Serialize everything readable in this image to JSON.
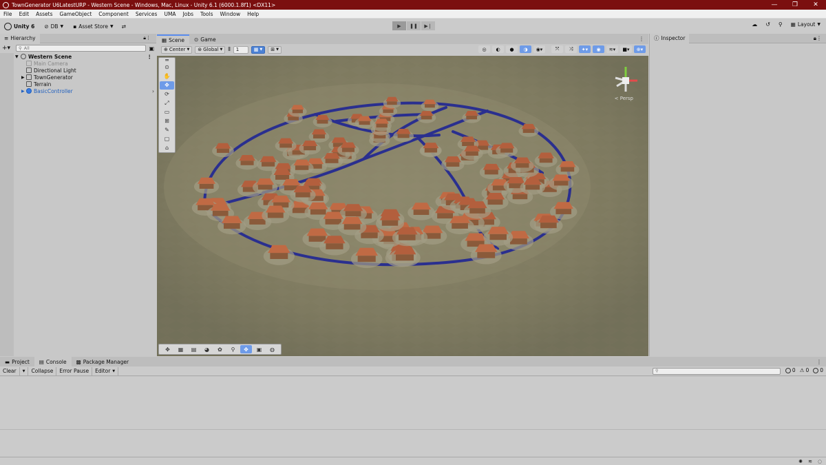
{
  "window": {
    "title": "TownGenerator U6LatestURP - Western Scene - Windows, Mac, Linux - Unity 6.1 (6000.1.8f1) <DX11>"
  },
  "menu": [
    "File",
    "Edit",
    "Assets",
    "GameObject",
    "Component",
    "Services",
    "UMA",
    "Jobs",
    "Tools",
    "Window",
    "Help"
  ],
  "toolbar": {
    "account": "Unity 6",
    "db": "DB",
    "asset_store": "Asset Store",
    "layout": "Layout"
  },
  "hierarchy": {
    "tab": "Hierarchy",
    "search_placeholder": "All",
    "scene": "Western Scene",
    "items": [
      {
        "label": "Main Camera",
        "state": "dim"
      },
      {
        "label": "Directional Light",
        "state": "normal"
      },
      {
        "label": "TownGenerator",
        "state": "normal"
      },
      {
        "label": "Terrain",
        "state": "normal"
      },
      {
        "label": "BasicController",
        "state": "prefab"
      }
    ]
  },
  "scene_view": {
    "tabs": [
      "Scene",
      "Game"
    ],
    "pivot": "Center",
    "space": "Global",
    "snap_value": "1",
    "projection_label": "< Persp"
  },
  "inspector": {
    "tab": "Inspector"
  },
  "bottom": {
    "tabs": [
      "Project",
      "Console",
      "Package Manager"
    ],
    "console_buttons": [
      "Clear",
      "Collapse",
      "Error Pause",
      "Editor"
    ],
    "counts": {
      "log": "0",
      "warn": "0",
      "error": "0"
    }
  },
  "colors": {
    "titlebar": "#7b0f0f",
    "selected_blue": "#4c82d6",
    "prefab_blue": "#1f5fbf"
  }
}
